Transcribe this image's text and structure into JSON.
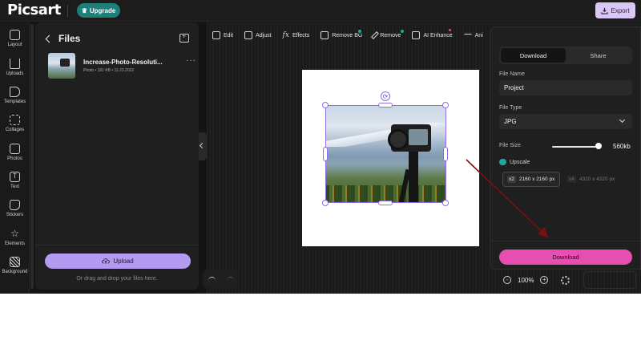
{
  "app": {
    "logo": "Picsart",
    "upgrade_label": "Upgrade",
    "export_label": "Export"
  },
  "rail": {
    "items": [
      {
        "label": "Layout",
        "icon": "layout-icon"
      },
      {
        "label": "Uploads",
        "icon": "upload-icon"
      },
      {
        "label": "Templates",
        "icon": "templates-icon"
      },
      {
        "label": "Collages",
        "icon": "collages-icon"
      },
      {
        "label": "Photos",
        "icon": "photos-icon"
      },
      {
        "label": "Text",
        "icon": "text-icon"
      },
      {
        "label": "Stickers",
        "icon": "stickers-icon"
      },
      {
        "label": "Elements",
        "icon": "elements-icon"
      },
      {
        "label": "Background",
        "icon": "background-icon"
      }
    ]
  },
  "files": {
    "title": "Files",
    "file": {
      "name": "Increase-Photo-Resoluti...",
      "meta": "Photo • 161 KB • 11.23.2022"
    },
    "upload_label": "Upload",
    "upload_hint": "Or drag and drop your files here."
  },
  "toolbar": {
    "items": [
      {
        "label": "Edit",
        "icon": "edit-icon"
      },
      {
        "label": "Adjust",
        "icon": "adjust-icon"
      },
      {
        "label": "Effects",
        "icon": "effects-icon"
      },
      {
        "label": "Remove BG",
        "icon": "remove-bg-icon"
      },
      {
        "label": "Remove",
        "icon": "remove-icon"
      },
      {
        "label": "AI Enhance",
        "icon": "ai-enhance-icon"
      },
      {
        "label": "Ani",
        "icon": "animate-icon"
      }
    ]
  },
  "zoom": {
    "value": "100%"
  },
  "export_panel": {
    "tabs": [
      "Download",
      "Share"
    ],
    "file_name_label": "File Name",
    "file_name_value": "Project",
    "file_type_label": "File Type",
    "file_type_value": "JPG",
    "file_size_label": "File Size",
    "file_size_value": "560kb",
    "file_size_level": 1.0,
    "upscale_label": "Upscale",
    "options": [
      {
        "tag": "x2",
        "label": "2160 x 2160 px"
      },
      {
        "tag": "x4",
        "label": "4320 x 4320 px"
      }
    ],
    "download_label": "Download"
  },
  "colors": {
    "accent_purple": "#b49af0",
    "download_pink": "#e64fb0",
    "upgrade_teal": "#1e7f78",
    "annotation_arrow": "#7a1010"
  }
}
